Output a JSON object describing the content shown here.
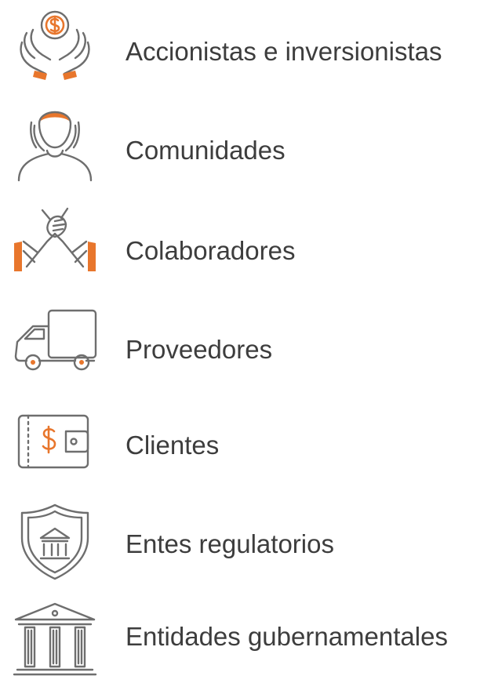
{
  "stakeholders": [
    {
      "label": "Accionistas e inversionistas",
      "icon": "hands-coin-icon"
    },
    {
      "label": "Comunidades",
      "icon": "person-icon"
    },
    {
      "label": "Colaboradores",
      "icon": "handshake-icon"
    },
    {
      "label": "Proveedores",
      "icon": "truck-icon"
    },
    {
      "label": "Clientes",
      "icon": "wallet-icon"
    },
    {
      "label": "Entes regulatorios",
      "icon": "shield-bank-icon"
    },
    {
      "label": "Entidades gubernamentales",
      "icon": "government-building-icon"
    }
  ],
  "colors": {
    "accent": "#e8762c",
    "icon_stroke": "#6e6e6e",
    "text": "#3d3d3d"
  }
}
